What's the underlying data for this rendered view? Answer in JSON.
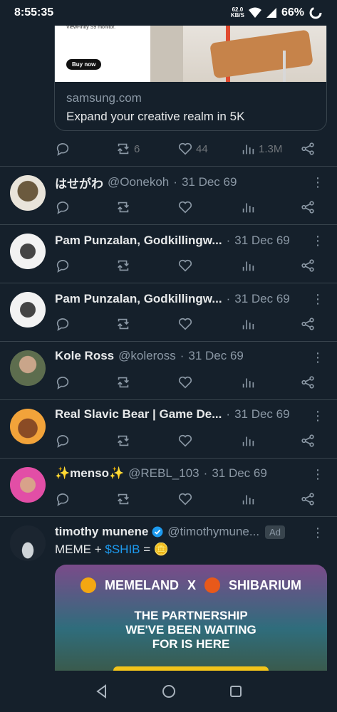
{
  "status_bar": {
    "time": "8:55:35",
    "net_speed": "62.0",
    "net_unit": "KB/S",
    "battery": "66%"
  },
  "ad_card": {
    "brand_line": "ViewFinity S9 monitor.",
    "buy_button": "Buy now",
    "domain": "samsung.com",
    "title": "Expand your creative realm in 5K",
    "stats": {
      "reposts": "6",
      "likes": "44",
      "views": "1.3M"
    }
  },
  "tweets": [
    {
      "name": "はせがわ",
      "handle": "@Oonekoh",
      "date": "31 Dec 69"
    },
    {
      "name": "Pam Punzalan, Godkillingw...",
      "handle": "",
      "date": "31 Dec 69"
    },
    {
      "name": "Pam Punzalan, Godkillingw...",
      "handle": "",
      "date": "31 Dec 69"
    },
    {
      "name": "Kole Ross",
      "handle": "@koleross",
      "date": "31 Dec 69"
    },
    {
      "name": "Real Slavic Bear | Game De...",
      "handle": "",
      "date": "31 Dec 69"
    },
    {
      "name": "✨menso✨",
      "handle": "@REBL_103",
      "date": "31 Dec 69"
    }
  ],
  "promoted": {
    "name": "timothy munene",
    "handle": "@timothymune...",
    "ad_label": "Ad",
    "text_prefix": "MEME + ",
    "cashtag": "$SHIB",
    "text_suffix": " = 🪙",
    "card": {
      "left_brand": "MEMELAND",
      "x": "X",
      "right_brand": "SHIBARIUM",
      "headline": [
        "THE PARTNERSHIP",
        "WE'VE BEEN WAITING",
        "FOR IS HERE"
      ]
    }
  },
  "separator": "·",
  "more_glyph": "⋮",
  "colors": {
    "background": "#15202b",
    "accent": "#1d9bf0",
    "muted": "#8b98a5",
    "divider": "#38444d"
  }
}
